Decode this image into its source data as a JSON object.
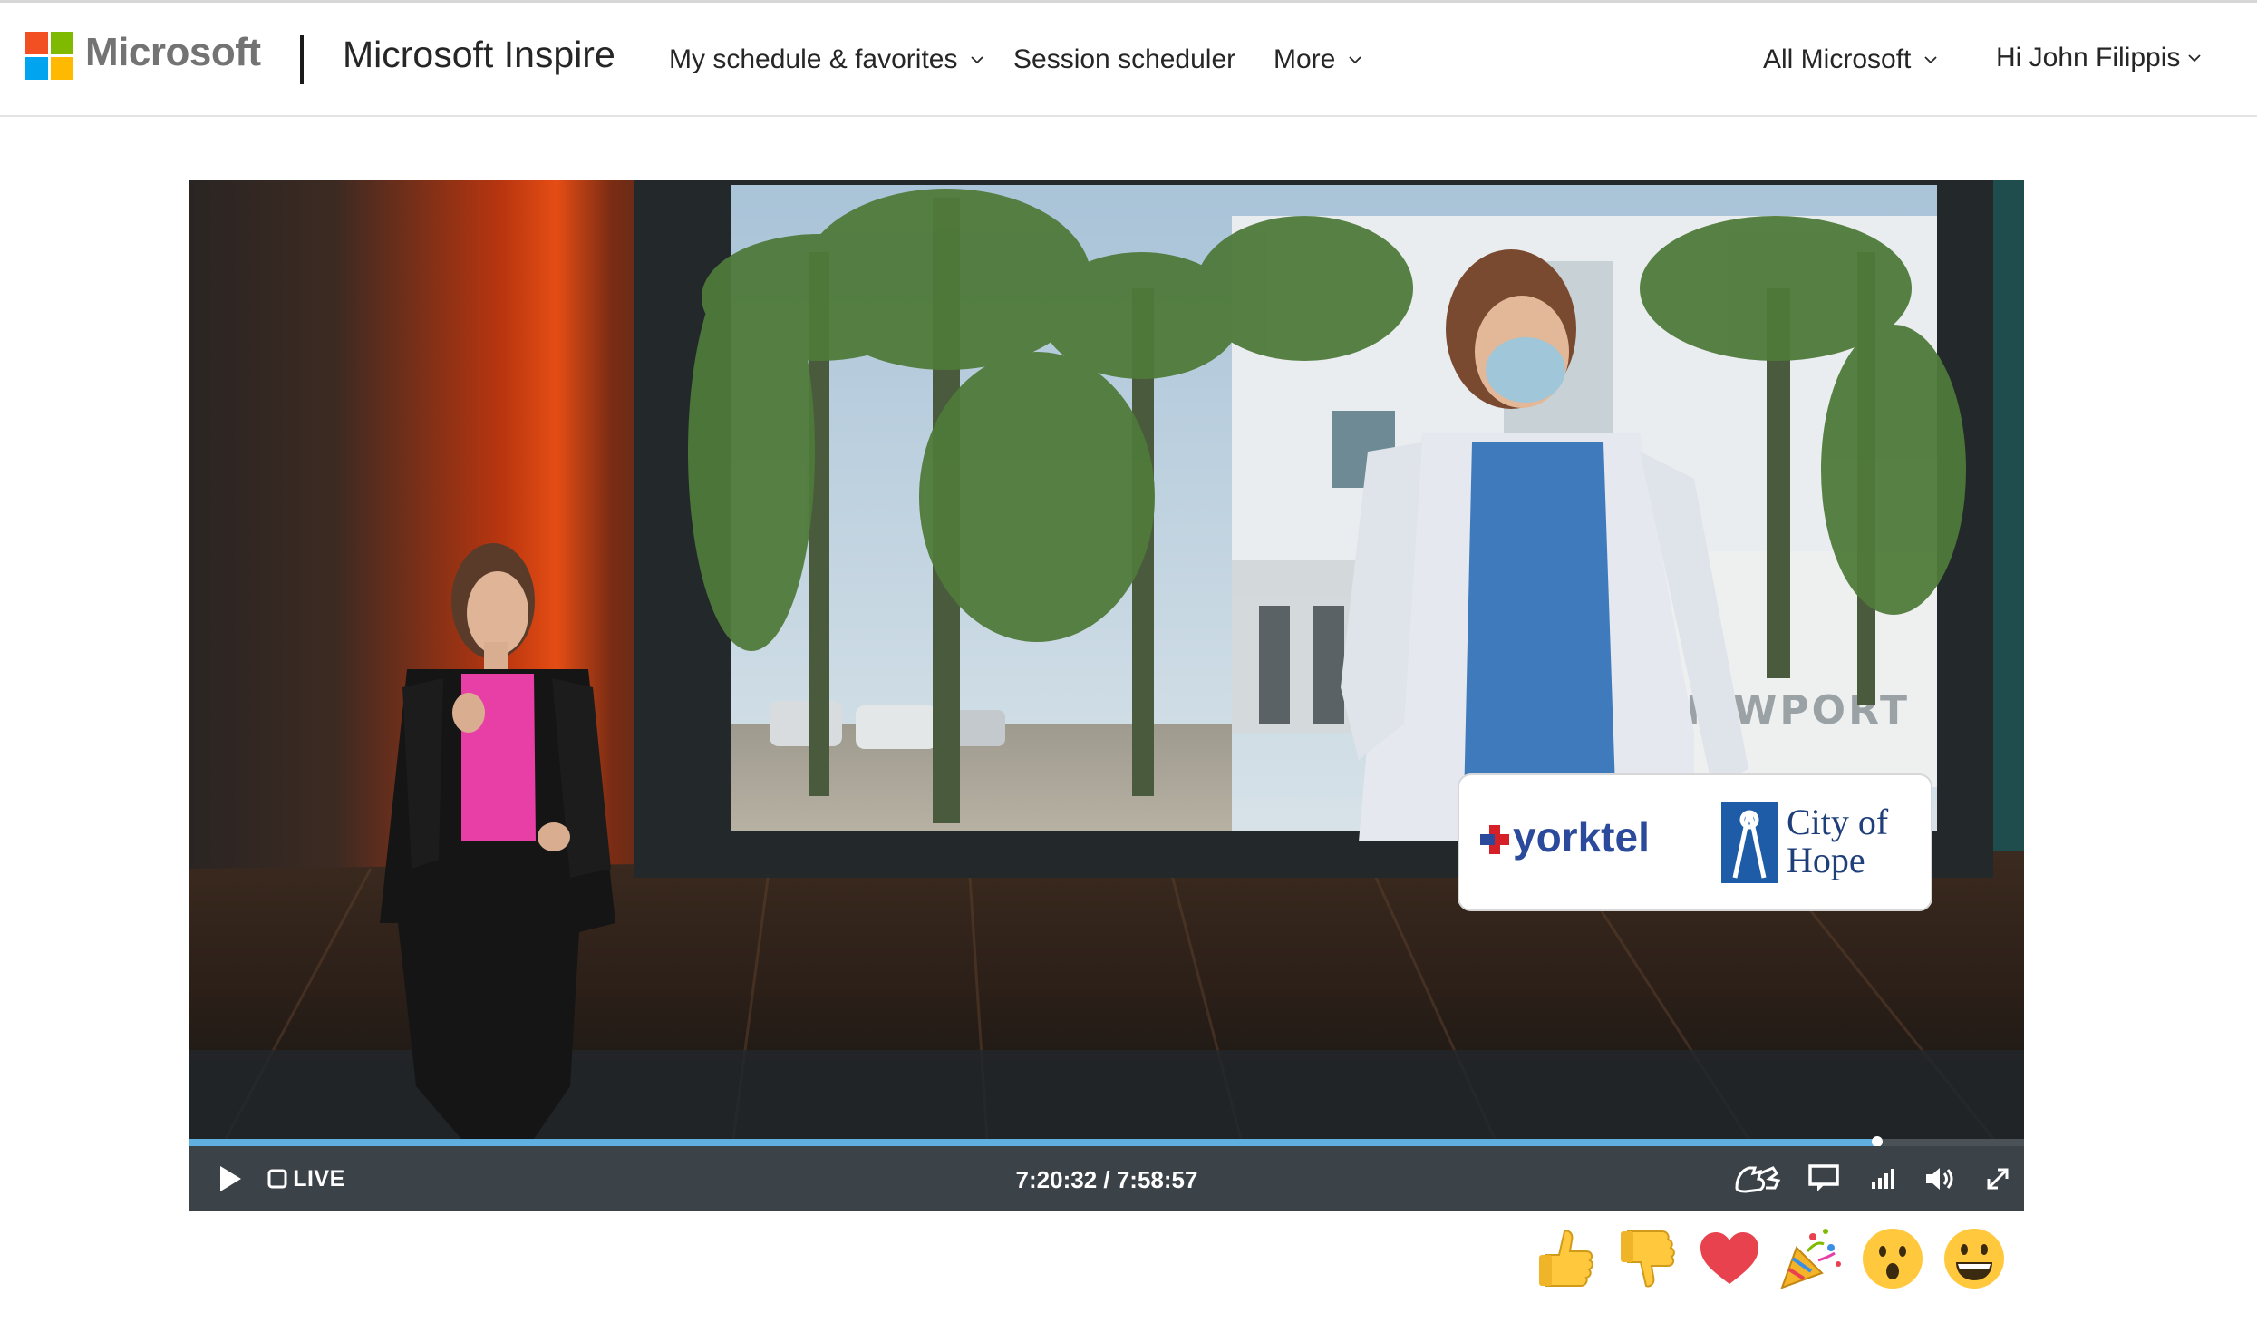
{
  "header": {
    "brand": "Microsoft",
    "site_title": "Microsoft Inspire",
    "nav": {
      "schedule": "My schedule & favorites",
      "scheduler": "Session scheduler",
      "more": "More"
    },
    "all_microsoft": "All Microsoft",
    "user_greeting": "Hi John Filippis"
  },
  "video": {
    "sponsor_left": "yorktel",
    "sponsor_right_line1": "City of",
    "sponsor_right_line2": "Hope",
    "building_sign": "NEWPORT",
    "live_label": "LIVE",
    "time_display": "7:20:32 / 7:58:57",
    "progress_fraction": 0.92
  },
  "reactions": [
    "thumbs-up",
    "thumbs-down",
    "heart",
    "party",
    "surprised",
    "grin"
  ],
  "colors": {
    "ms_red": "#f25022",
    "ms_green": "#7fba00",
    "ms_blue": "#00a4ef",
    "ms_yellow": "#ffb900",
    "progress": "#5fb0e0",
    "control_bar": "#3b4248"
  }
}
